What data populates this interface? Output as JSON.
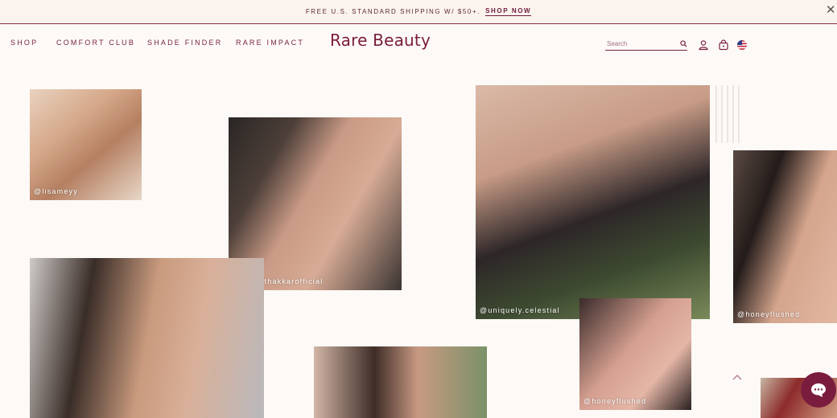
{
  "banner": {
    "text": "FREE U.S. STANDARD SHIPPING W/ $50+.",
    "cta": "SHOP NOW"
  },
  "nav": {
    "items": [
      "SHOP",
      "COMFORT CLUB",
      "SHADE FINDER",
      "RARE IMPACT"
    ]
  },
  "brand": {
    "logo": "Rare Beauty",
    "accent": "#7a1c3d"
  },
  "search": {
    "placeholder": "Search"
  },
  "header_icons": [
    "search-icon",
    "account-icon",
    "cart-icon",
    "us-flag-icon"
  ],
  "gallery": {
    "tags": [
      "@lisameyy",
      "@maitrithakkarofficial",
      "@uniquely.celestial",
      "@honeyflushed",
      "@honeyflushed"
    ]
  }
}
